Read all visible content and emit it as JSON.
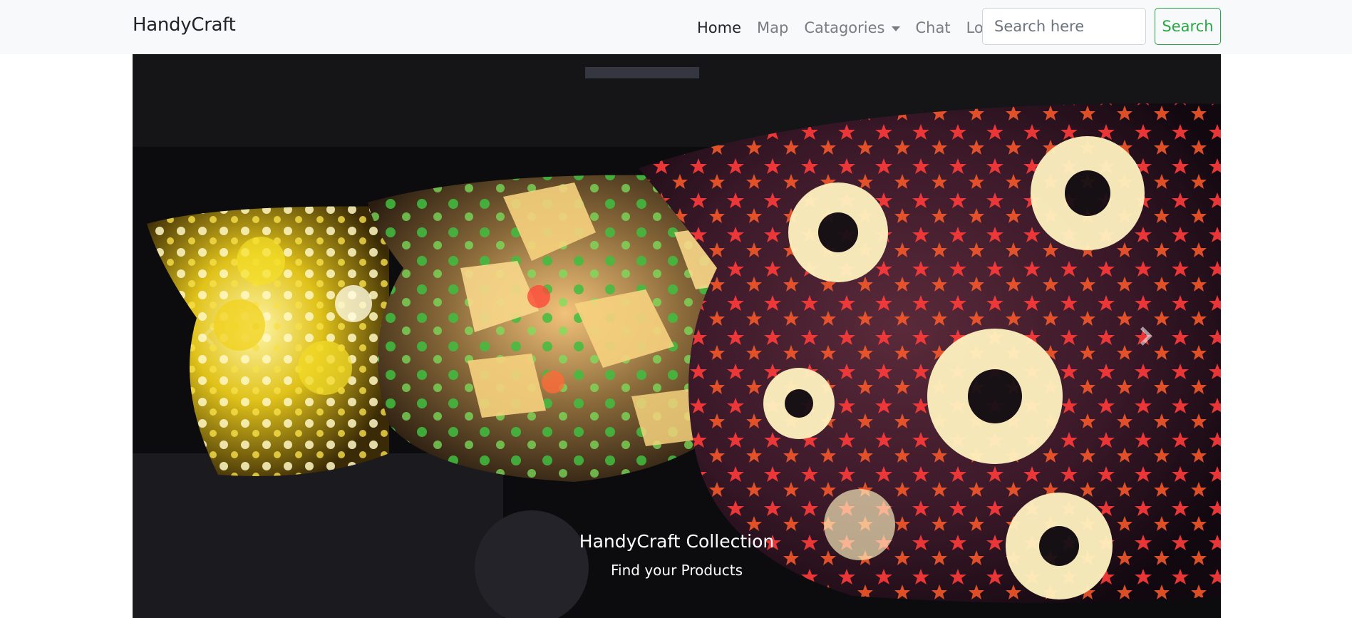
{
  "navbar": {
    "brand": "HandyCraft",
    "links": {
      "home": "Home",
      "map": "Map",
      "categories": "Catagories",
      "chat": "Chat",
      "login": "Login"
    },
    "search": {
      "placeholder": "Search here",
      "value": "",
      "button_label": "Search"
    }
  },
  "carousel": {
    "image_alt": "Colorful mosaic glass lamps with flower and star patterns",
    "caption": {
      "title": "HandyCraft Collection",
      "subtitle": "Find your Products"
    }
  },
  "colors": {
    "navbar_bg": "#f8f9fa",
    "search_button": "#28a745",
    "caption_text": "#ffffff"
  },
  "icons": {
    "prev": "chevron-left-icon",
    "next": "chevron-right-icon",
    "dropdown": "caret-down-icon"
  }
}
